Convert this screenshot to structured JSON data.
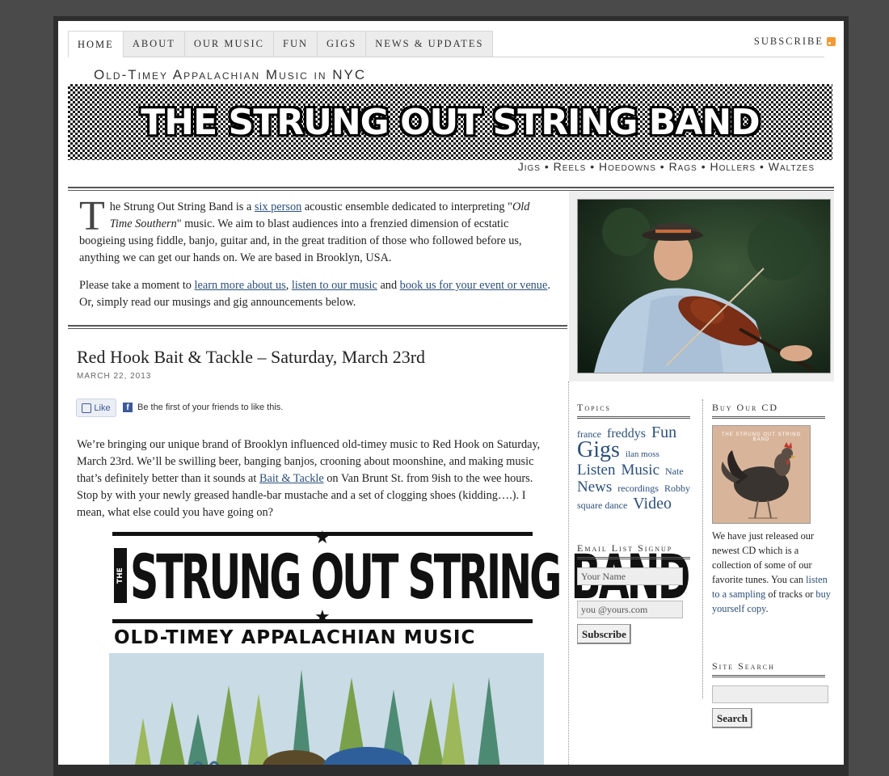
{
  "nav": {
    "items": [
      "Home",
      "About",
      "Our Music",
      "Fun",
      "Gigs",
      "News & Updates"
    ],
    "subscribe_label": "Subscribe"
  },
  "header": {
    "tagline": "Old-Timey Appalachian Music in NYC",
    "banner_title": "THE STRUNG OUT STRING BAND",
    "genres": "Jigs • Reels • Hoedowns • Rags • Hollers • Waltzes"
  },
  "intro": {
    "dropcap": "T",
    "p1_a": "he Strung Out String Band is a ",
    "p1_link": "six person",
    "p1_b": " acoustic ensemble dedicated to interpreting \"",
    "p1_em": "Old Time Southern",
    "p1_c": "\" music. We aim to blast audiences into a frenzied dimension of ecstatic boogieing using fiddle, banjo, guitar and, in the great tradition of those who followed before us, anything we can get our hands on. We are based in Brooklyn, USA.",
    "p2_a": "Please take a moment to ",
    "p2_link1": "learn more about us",
    "p2_b": ", ",
    "p2_link2": "listen to our music",
    "p2_c": " and ",
    "p2_link3": "book us for your event or venue",
    "p2_d": ". Or, simply read our musings and gig announcements below."
  },
  "post": {
    "title": "Red Hook Bait & Tackle – Saturday, March 23rd",
    "date": "MARCH 22, 2013",
    "like_label": "Like",
    "like_text": "Be the first of your friends to like this.",
    "body_a": "We’re bringing our unique brand of Brooklyn influenced old-timey music to Red Hook on Saturday, March 23rd.  We’ll be swilling beer, banging banjos, crooning about moonshine, and making music that’s definitely better than it sounds at ",
    "body_link": "Bait & Tackle",
    "body_b": " on Van Brunt St. from 9ish to the wee hours.  Stop by with your newly greased handle-bar mustache and a set of clogging shoes (kidding….).  I mean, what else could you have going on?"
  },
  "poster": {
    "the": "THE",
    "title": "STRUNG OUT STRING BAND",
    "subtitle": "OLD-TIMEY APPALACHIAN MUSIC"
  },
  "sidebar": {
    "topics_title": "Topics",
    "tags": [
      {
        "label": "france",
        "size": 12
      },
      {
        "label": "freddys",
        "size": 16
      },
      {
        "label": "Fun",
        "size": 20
      },
      {
        "label": "Gigs",
        "size": 28
      },
      {
        "label": "ilan moss",
        "size": 11
      },
      {
        "label": "Listen",
        "size": 19
      },
      {
        "label": "Music",
        "size": 19
      },
      {
        "label": "Nate",
        "size": 12
      },
      {
        "label": "News",
        "size": 19
      },
      {
        "label": "recordings",
        "size": 12
      },
      {
        "label": "Robby",
        "size": 12
      },
      {
        "label": "square dance",
        "size": 12
      },
      {
        "label": "Video",
        "size": 20
      }
    ],
    "email_title": "Email List Signup",
    "name_placeholder": "Your Name",
    "email_placeholder": "you @yours.com",
    "subscribe_button": "Subscribe",
    "cd_title": "Buy Our CD",
    "cd_cover_text": "THE STRUNG OUT STRING BAND",
    "cd_text_a": "We have just released our newest CD which is a collection of some of our favorite tunes. You can ",
    "cd_link1": "listen to a sampling",
    "cd_text_b": " of tracks or ",
    "cd_link2": "buy yourself copy",
    "cd_text_c": ".",
    "search_title": "Site Search",
    "search_button": "Search"
  }
}
